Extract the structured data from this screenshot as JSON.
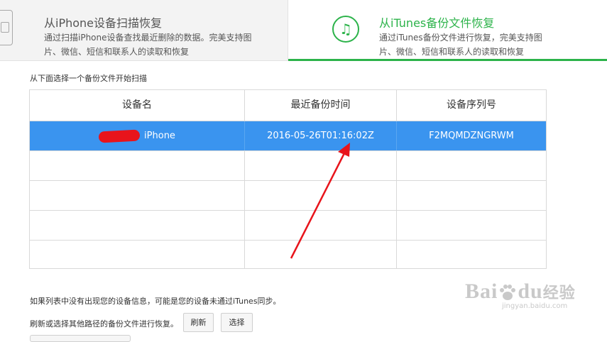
{
  "tabs": {
    "device_scan": {
      "title": "从iPhone设备扫描恢复",
      "desc": "通过扫描iPhone设备查找最近删除的数据。完美支持图片、微信、短信和联系人的读取和恢复"
    },
    "itunes_backup": {
      "title": "从iTunes备份文件恢复",
      "desc": "通过iTunes备份文件进行恢复，完美支持图片、微信、短信和联系人的读取和恢复",
      "accent": "#2cb34a"
    }
  },
  "instruction": "从下面选择一个备份文件开始扫描",
  "table": {
    "columns": [
      "设备名",
      "最近备份时间",
      "设备序列号"
    ],
    "rows": [
      {
        "device_name": "iPhone",
        "backup_time": "2016-05-26T01:16:02Z",
        "serial": "F2MQMDZNGRWM"
      }
    ],
    "selected_color": "#3a94ef"
  },
  "notes": {
    "line1": "如果列表中没有出现您的设备信息，可能是您的设备未通过iTunes同步。",
    "line2": "刷新或选择其他路径的备份文件进行恢复。"
  },
  "buttons": {
    "refresh": "刷新",
    "select": "选择"
  },
  "watermark": {
    "brand": "Bai",
    "brand_tail": "du",
    "cn": "经验",
    "url": "jingyan.baidu.com"
  },
  "icons": {
    "device": "phone-icon",
    "itunes": "music-note-icon"
  }
}
